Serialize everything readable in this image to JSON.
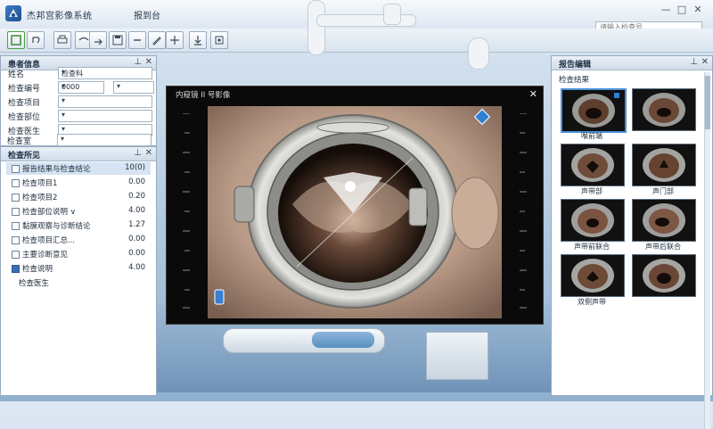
{
  "window": {
    "title": "杰邦宫影像系统",
    "subtitle": "报到台",
    "controls": [
      "—",
      "□",
      "✕"
    ]
  },
  "toolbar": {
    "search_placeholder": "请输入检查号",
    "buttons": [
      "new-icon",
      "undo-icon",
      "print-icon",
      "link-icon",
      "redo-icon",
      "save-icon",
      "cancel-icon",
      "edit-icon",
      "move-icon",
      "download-icon",
      "settings-icon"
    ]
  },
  "patient_panel": {
    "title": "患者信息",
    "pin": "⊥",
    "close": "✕",
    "fields": [
      {
        "label": "姓名",
        "value": "检查科"
      },
      {
        "label": "检查编号",
        "value": "0000",
        "value2": ""
      },
      {
        "label": "检查项目",
        "value": ""
      },
      {
        "label": "检查部位",
        "value": ""
      },
      {
        "label": "检查医生",
        "value": ""
      },
      {
        "label": "检查室",
        "value": ""
      }
    ]
  },
  "findings_panel": {
    "title": "检查所见",
    "pin": "⊥",
    "close": "✕",
    "rows": [
      {
        "label": "报告结果与检查结论",
        "value": "10(0)",
        "checked": false,
        "selected": true
      },
      {
        "label": "检查项目1",
        "value": "0.00",
        "checked": false
      },
      {
        "label": "检查项目2",
        "value": "0.20",
        "checked": false
      },
      {
        "label": "检查部位说明 ∨",
        "value": "4.00",
        "checked": false
      },
      {
        "label": "黏膜观察与诊断结论",
        "value": "1.27",
        "checked": false
      },
      {
        "label": "检查项目汇总...",
        "value": "0.00",
        "checked": false
      },
      {
        "label": "主要诊断意见",
        "value": "0.00",
        "checked": false
      },
      {
        "label": "检查说明",
        "value": "4.00",
        "checked": true
      },
      {
        "label": "检查医生",
        "value": "",
        "checked": null
      }
    ]
  },
  "viewer": {
    "title": "内窥镜 II 号影像",
    "close": "✕"
  },
  "report_panel": {
    "title": "报告编辑",
    "subtitle": "检查结果",
    "pin": "⊥",
    "close": "✕",
    "thumbnails": [
      {
        "caption": "喉前端"
      },
      {
        "caption": ""
      },
      {
        "caption": "声带部"
      },
      {
        "caption": "声门部"
      },
      {
        "caption": "声带前联合"
      },
      {
        "caption": "声带后联合"
      },
      {
        "caption": "双侧声带"
      },
      {
        "caption": ""
      }
    ]
  },
  "colors": {
    "accent": "#3c6fb1",
    "panel_border": "#97aac0",
    "viewer_bg": "#0a0a0a"
  }
}
